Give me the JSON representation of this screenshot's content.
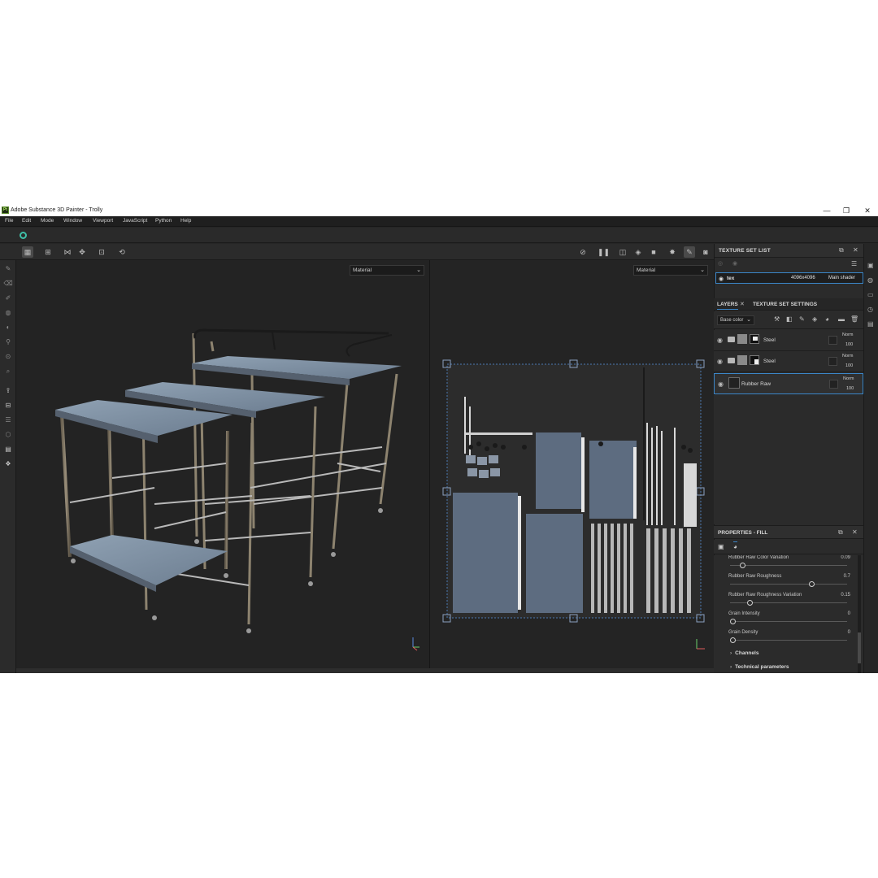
{
  "window": {
    "title": "Adobe Substance 3D Painter - Trolly",
    "logo_text": "Pt",
    "controls": [
      "—",
      "❐",
      "✕"
    ]
  },
  "menu": [
    "File",
    "Edit",
    "Mode",
    "Window",
    "Viewport",
    "JavaScript",
    "Python",
    "Help"
  ],
  "viewport_3d": {
    "display_mode": "Material",
    "icon": "3d-trolley-tables-model"
  },
  "viewport_2d": {
    "display_mode": "Material",
    "icon": "uv-texture-atlas"
  },
  "texture_set_list": {
    "title": "TEXTURE SET LIST",
    "rows": [
      {
        "name": "tex",
        "resolution": "4096x4096",
        "shader": "Main shader"
      }
    ]
  },
  "layers_panel": {
    "tabs": [
      "LAYERS",
      "TEXTURE SET SETTINGS"
    ],
    "channel": "Base color",
    "layers": [
      {
        "name": "Steel",
        "blend": "Norm",
        "opacity": "100"
      },
      {
        "name": "Steel",
        "blend": "Norm",
        "opacity": "100"
      },
      {
        "name": "Rubber Raw",
        "blend": "Norm",
        "opacity": "100"
      }
    ]
  },
  "properties": {
    "title": "PROPERTIES - FILL",
    "params": [
      {
        "label": "Rubber Raw Color Variation",
        "value": "0.09",
        "fraction": 0.09
      },
      {
        "label": "Rubber Raw Roughness",
        "value": "0.7",
        "fraction": 0.7
      },
      {
        "label": "Rubber Raw Roughness Variation",
        "value": "0.15",
        "fraction": 0.15
      },
      {
        "label": "Grain Intensity",
        "value": "0",
        "fraction": 0
      },
      {
        "label": "Grain Density",
        "value": "0",
        "fraction": 0
      }
    ],
    "groups": [
      "Channels",
      "Technical parameters"
    ]
  },
  "colors": {
    "accent": "#3b86c8",
    "sync": "#3fc0a8",
    "bg": "#262626"
  }
}
